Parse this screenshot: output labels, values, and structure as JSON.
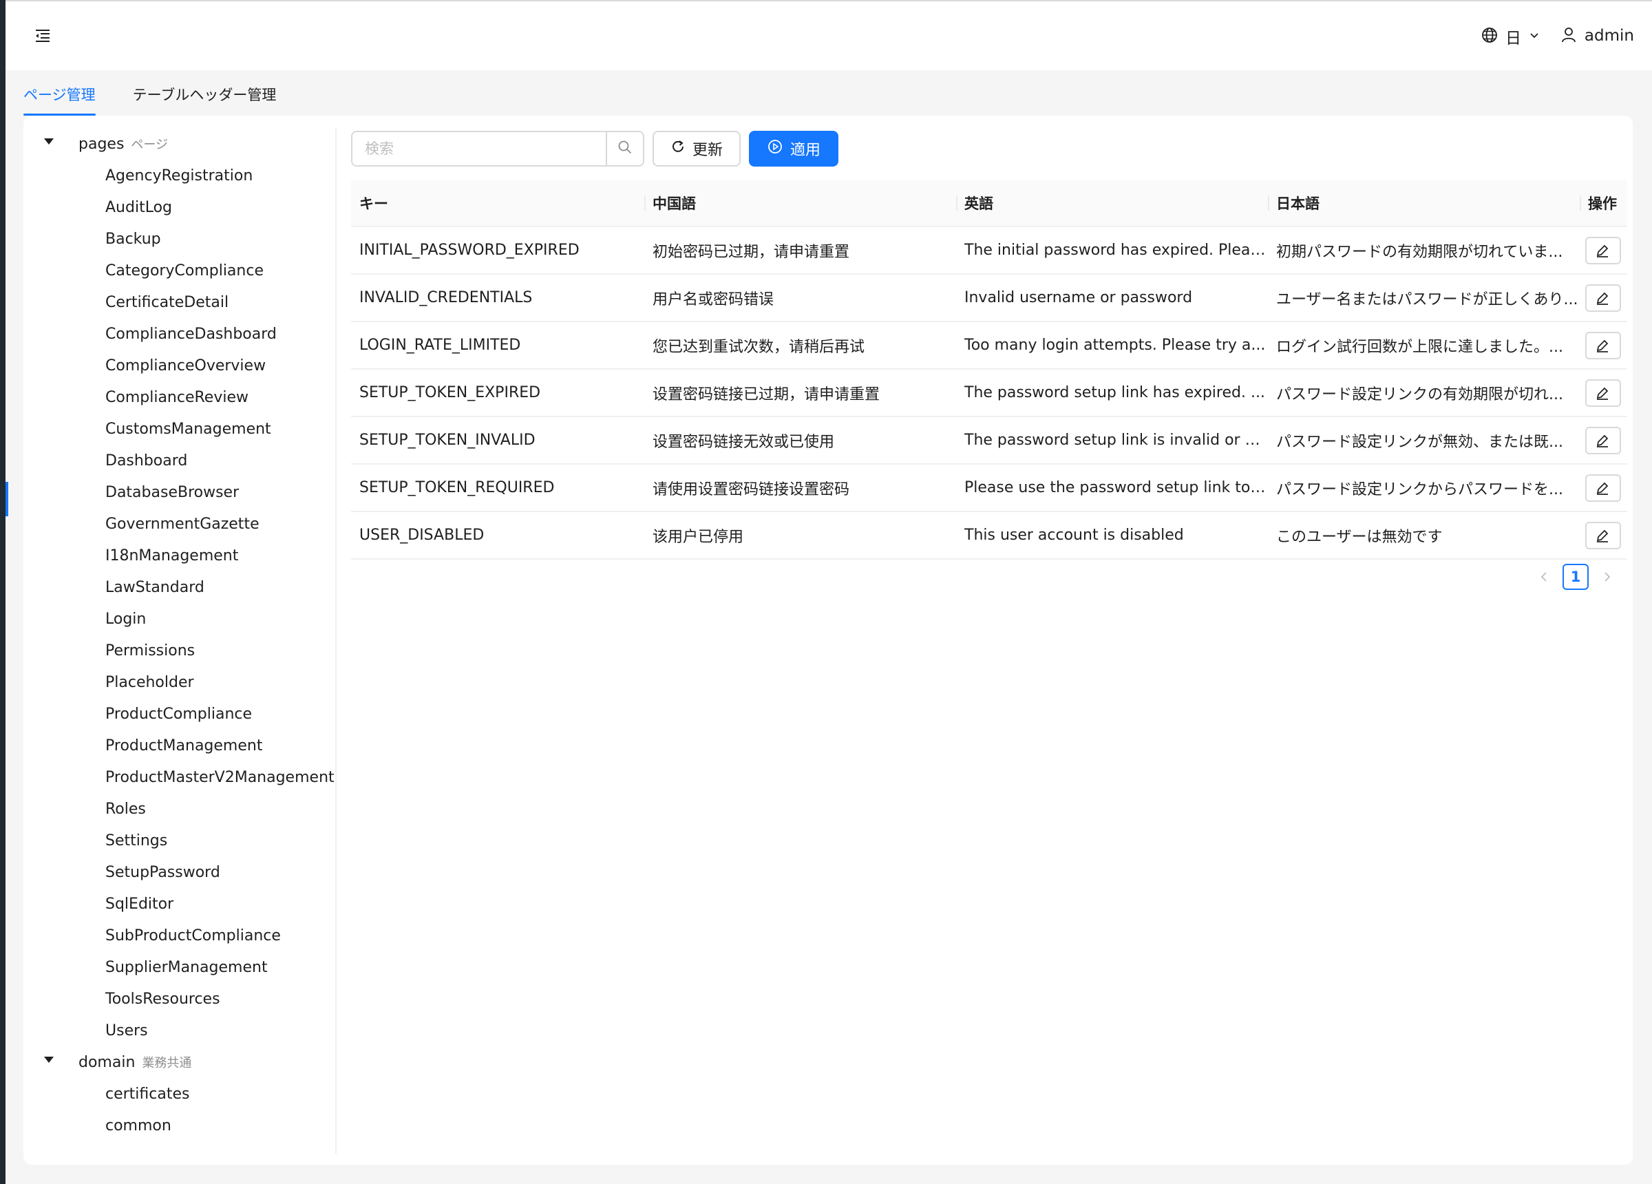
{
  "header": {
    "language_label": "日",
    "user_name": "admin"
  },
  "tabs": [
    {
      "label": "ページ管理",
      "active": true
    },
    {
      "label": "テーブルヘッダー管理",
      "active": false
    }
  ],
  "tree": {
    "pages": {
      "label": "pages",
      "sub": "ページ",
      "items": [
        "AgencyRegistration",
        "AuditLog",
        "Backup",
        "CategoryCompliance",
        "CertificateDetail",
        "ComplianceDashboard",
        "ComplianceOverview",
        "ComplianceReview",
        "CustomsManagement",
        "Dashboard",
        "DatabaseBrowser",
        "GovernmentGazette",
        "I18nManagement",
        "LawStandard",
        "Login",
        "Permissions",
        "Placeholder",
        "ProductCompliance",
        "ProductManagement",
        "ProductMasterV2Management",
        "Roles",
        "Settings",
        "SetupPassword",
        "SqlEditor",
        "SubProductCompliance",
        "SupplierManagement",
        "ToolsResources",
        "Users"
      ]
    },
    "domain": {
      "label": "domain",
      "sub": "業務共通",
      "items": [
        "certificates",
        "common"
      ]
    }
  },
  "toolbar": {
    "search_placeholder": "検索",
    "refresh_label": "更新",
    "apply_label": "適用"
  },
  "table": {
    "headers": [
      "キー",
      "中国語",
      "英語",
      "日本語",
      "操作"
    ],
    "rows": [
      {
        "key": "INITIAL_PASSWORD_EXPIRED",
        "zh": "初始密码已过期，请申请重置",
        "en": "The initial password has expired. Pleas...",
        "ja": "初期パスワードの有効期限が切れていま..."
      },
      {
        "key": "INVALID_CREDENTIALS",
        "zh": "用户名或密码错误",
        "en": "Invalid username or password",
        "ja": "ユーザー名またはパスワードが正しくあり..."
      },
      {
        "key": "LOGIN_RATE_LIMITED",
        "zh": "您已达到重试次数，请稍后再试",
        "en": "Too many login attempts. Please try a...",
        "ja": "ログイン試行回数が上限に達しました。..."
      },
      {
        "key": "SETUP_TOKEN_EXPIRED",
        "zh": "设置密码链接已过期，请申请重置",
        "en": "The password setup link has expired. ...",
        "ja": "パスワード設定リンクの有効期限が切れ..."
      },
      {
        "key": "SETUP_TOKEN_INVALID",
        "zh": "设置密码链接无效或已使用",
        "en": "The password setup link is invalid or h...",
        "ja": "パスワード設定リンクが無効、または既..."
      },
      {
        "key": "SETUP_TOKEN_REQUIRED",
        "zh": "请使用设置密码链接设置密码",
        "en": "Please use the password setup link to ...",
        "ja": "パスワード設定リンクからパスワードを..."
      },
      {
        "key": "USER_DISABLED",
        "zh": "该用户已停用",
        "en": "This user account is disabled",
        "ja": "このユーザーは無効です"
      }
    ]
  },
  "pagination": {
    "current_page": "1"
  }
}
